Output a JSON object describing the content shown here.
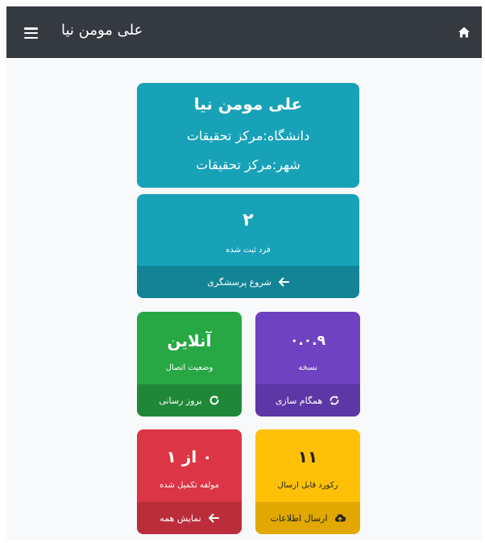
{
  "header": {
    "title": "علی مومن نیا",
    "menu_icon": "hamburger-menu-icon",
    "home_icon": "home-icon"
  },
  "profile": {
    "name": "علی مومن نیا",
    "university": "دانشگاه:مرکز تحقیقات",
    "city": "شهر:مرکز تحقیقات"
  },
  "registered": {
    "value": "۲",
    "label": "فرد ثبت شده",
    "action": "شروع پرسشگری",
    "icon": "arrow-left-icon"
  },
  "version": {
    "value": "۰.۰.۹",
    "label": "نسخه",
    "action": "همگام سازی",
    "icon": "sync-icon"
  },
  "connection": {
    "value": "آنلاین",
    "label": "وضعیت اتصال",
    "action": "بروز رسانی",
    "icon": "refresh-icon"
  },
  "records": {
    "value": "۱۱",
    "label": "رکورد قابل ارسال",
    "action": "ارسال اطلاعات",
    "icon": "cloud-upload-icon"
  },
  "questionnaires": {
    "value": "۰ از ۱",
    "label": "مولفه تکمیل شده",
    "action": "نمایش همه",
    "icon": "arrow-left-icon"
  },
  "colors": {
    "topbar": "#343a40",
    "teal": "#17a2b8",
    "purple": "#6f42c1",
    "green": "#28a745",
    "red": "#dc3545",
    "yellow": "#ffc107"
  }
}
